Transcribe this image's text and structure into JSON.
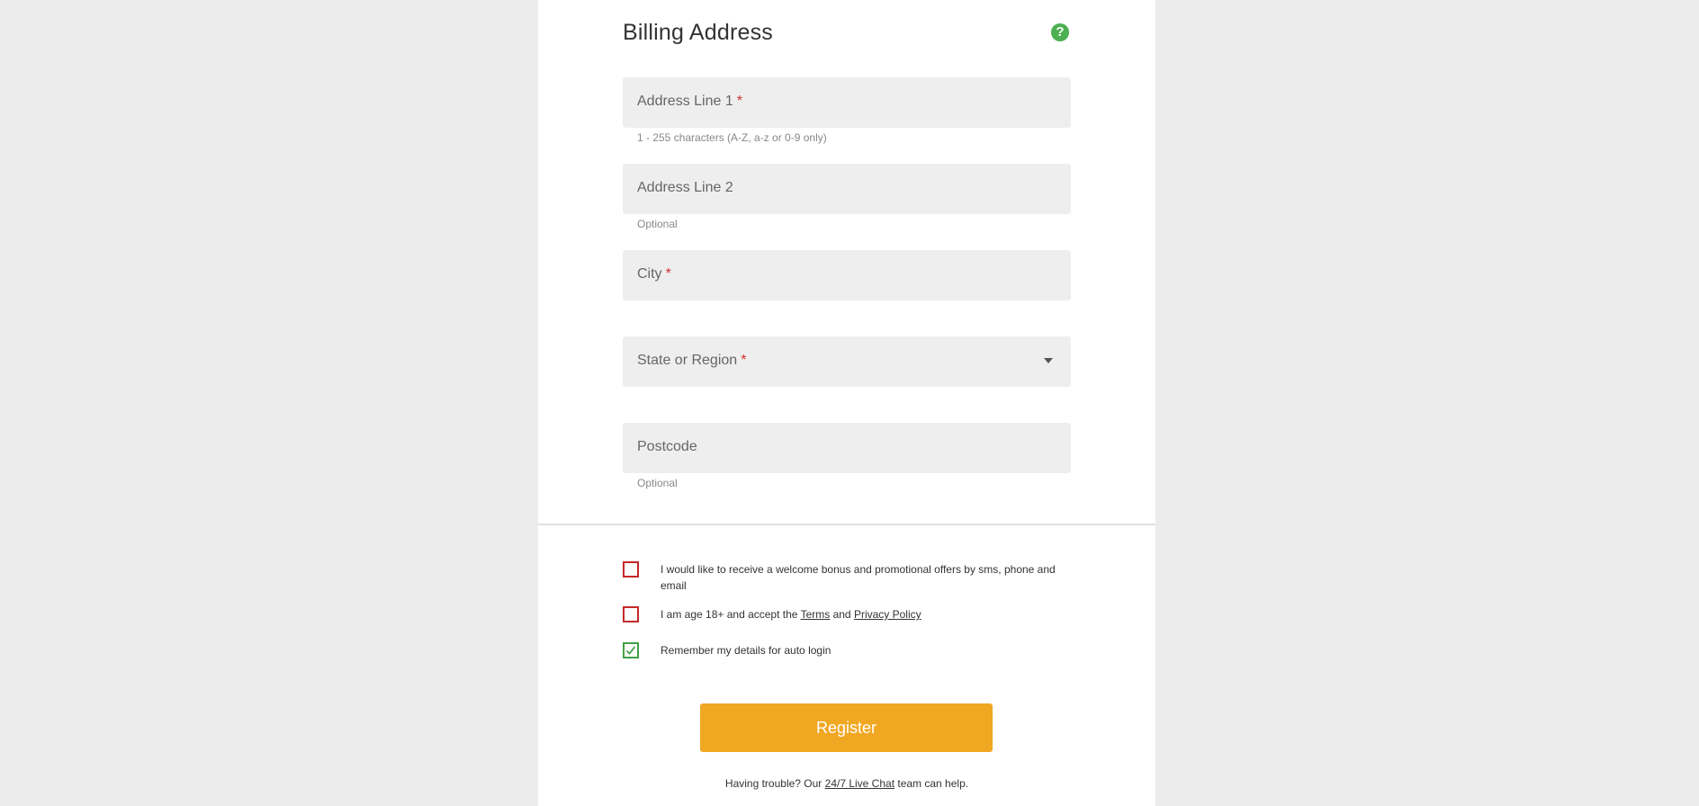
{
  "billing": {
    "title": "Billing Address",
    "help_icon": "question-circle-icon"
  },
  "fields": {
    "address1": {
      "label": "Address Line 1",
      "required_mark": "*",
      "hint": "1 - 255 characters (A-Z, a-z or 0-9 only)",
      "value": ""
    },
    "address2": {
      "label": "Address Line 2",
      "hint": "Optional",
      "value": ""
    },
    "city": {
      "label": "City",
      "required_mark": "*",
      "value": ""
    },
    "state": {
      "label": "State or Region",
      "required_mark": "*",
      "selected": ""
    },
    "postcode": {
      "label": "Postcode",
      "hint": "Optional",
      "value": ""
    }
  },
  "consents": {
    "promo": {
      "text": "I would like to receive a welcome bonus and promotional offers by sms, phone and email",
      "checked": false
    },
    "age": {
      "text_before": "I am age 18+ and accept the ",
      "terms_link": "Terms",
      "text_mid": " and ",
      "privacy_link": "Privacy Policy",
      "checked": false
    },
    "remember": {
      "text": "Remember my details for auto login",
      "checked": true
    }
  },
  "register_button": "Register",
  "help_text": {
    "before": "Having trouble? Our ",
    "link": "24/7 Live Chat",
    "after": " team can help."
  },
  "colors": {
    "accent": "#f0a722",
    "required": "#d32f2f",
    "checkbox_unchecked": "#c62828",
    "checkbox_checked": "#43a047",
    "help_icon": "#4caf50",
    "field_bg": "#eeeeee",
    "page_bg": "#ececec"
  }
}
